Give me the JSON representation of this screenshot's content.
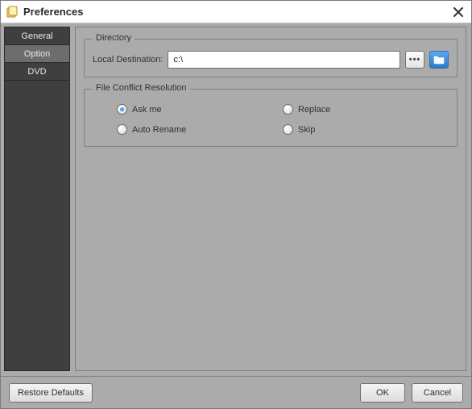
{
  "window": {
    "title": "Preferences"
  },
  "sidebar": {
    "items": [
      {
        "label": "General"
      },
      {
        "label": "Option"
      },
      {
        "label": "DVD"
      }
    ],
    "selected_index": 1
  },
  "directory": {
    "legend": "Directory",
    "dest_label": "Local Destination:",
    "dest_value": "c:\\",
    "more_button": "more-options",
    "browse_button": "browse-folder"
  },
  "conflict": {
    "legend": "File Conflict Resolution",
    "options": [
      {
        "label": "Ask me",
        "checked": true
      },
      {
        "label": "Replace",
        "checked": false
      },
      {
        "label": "Auto Rename",
        "checked": false
      },
      {
        "label": "Skip",
        "checked": false
      }
    ]
  },
  "buttons": {
    "restore": "Restore Defaults",
    "ok": "OK",
    "cancel": "Cancel"
  }
}
